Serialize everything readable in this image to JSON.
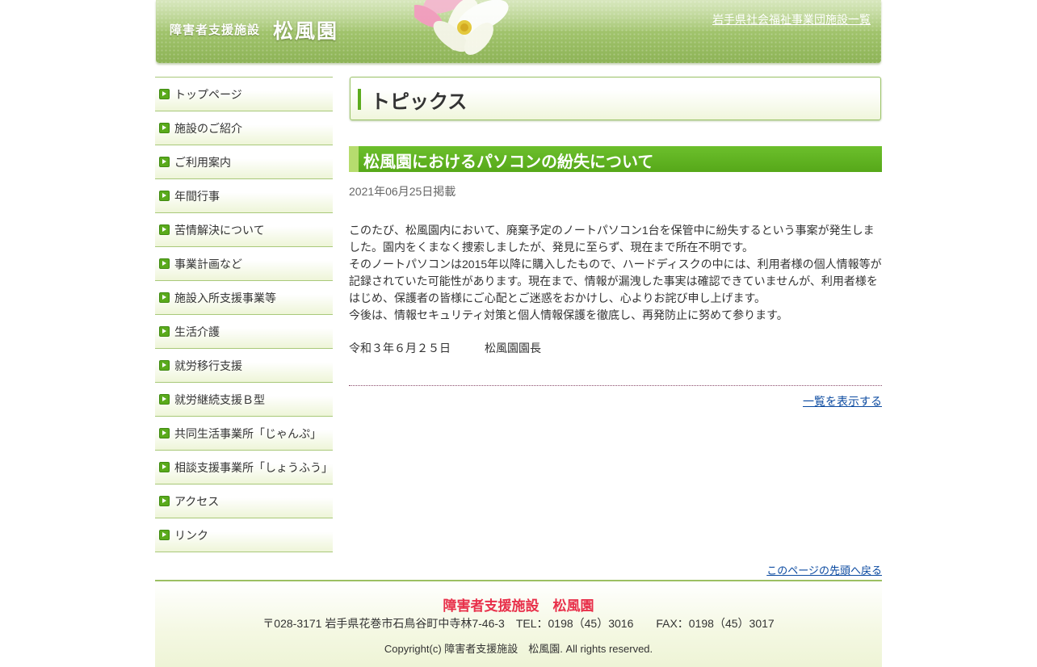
{
  "header": {
    "logo_small": "障害者支援施設",
    "logo_big": "松風園",
    "link": "岩手県社会福祉事業団施設一覧"
  },
  "sidebar": {
    "items": [
      {
        "label": "トップページ"
      },
      {
        "label": "施設のご紹介"
      },
      {
        "label": "ご利用案内"
      },
      {
        "label": "年間行事"
      },
      {
        "label": "苦情解決について"
      },
      {
        "label": "事業計画など"
      },
      {
        "label": "施設入所支援事業等"
      },
      {
        "label": "生活介護"
      },
      {
        "label": "就労移行支援"
      },
      {
        "label": "就労継続支援Ｂ型"
      },
      {
        "label": "共同生活事業所「じゃんぷ」"
      },
      {
        "label": "相談支援事業所「しょうふう」"
      },
      {
        "label": "アクセス"
      },
      {
        "label": "リンク"
      }
    ]
  },
  "main": {
    "section_title": "トピックス",
    "article": {
      "title": "松風園におけるパソコンの紛失について",
      "date": "2021年06月25日掲載",
      "paragraphs": [
        "このたび、松風園内において、廃棄予定のノートパソコン1台を保管中に紛失するという事案が発生しました。園内をくまなく捜索しましたが、発見に至らず、現在まで所在不明です。",
        "そのノートパソコンは2015年以降に購入したもので、ハードディスクの中には、利用者様の個人情報等が記録されていた可能性があります。現在まで、情報が漏洩した事実は確認できていませんが、利用者様をはじめ、保護者の皆様にご心配とご迷惑をおかけし、心よりお詫び申し上げます。",
        "今後は、情報セキュリティ対策と個人情報保護を徹底し、再発防止に努めて参ります。"
      ],
      "signature_date": "令和３年６月２５日",
      "signature_name": "松風園園長"
    },
    "list_link": "一覧を表示する",
    "pagetop_link": "このページの先頭へ戻る"
  },
  "footer": {
    "name": "障害者支援施設　松風園",
    "address": "〒028-3171 岩手県花巻市石鳥谷町中寺林7-46-3　TEL：0198（45）3016　　FAX：0198（45）3017",
    "copyright": "Copyright(c) 障害者支援施設　松風園. All rights reserved."
  },
  "colors": {
    "accent_green": "#5cab1e",
    "link_blue": "#0b4aa0",
    "footer_name_red": "#e8304a"
  }
}
